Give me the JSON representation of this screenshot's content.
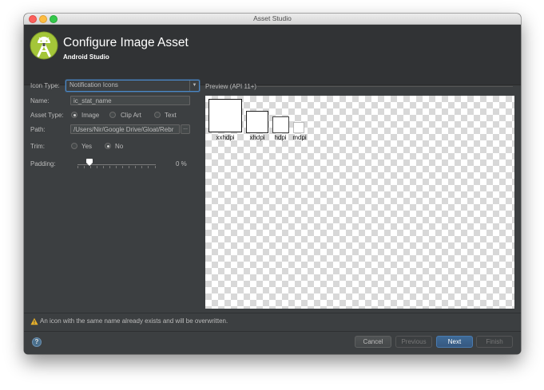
{
  "window": {
    "title": "Asset Studio"
  },
  "header": {
    "title": "Configure Image Asset",
    "subtitle": "Android Studio",
    "logo": "android-studio-logo"
  },
  "form": {
    "icon_type": {
      "label": "Icon Type:",
      "value": "Notification Icons"
    },
    "name": {
      "label": "Name:",
      "value": "ic_stat_name"
    },
    "asset_type": {
      "label": "Asset Type:",
      "options": [
        "Image",
        "Clip Art",
        "Text"
      ],
      "selected": "Image"
    },
    "path": {
      "label": "Path:",
      "value": "/Users/Nir/Google Drive/Gloat/Rebr",
      "browse_label": "..."
    },
    "trim": {
      "label": "Trim:",
      "options": [
        "Yes",
        "No"
      ],
      "selected": "No"
    },
    "padding": {
      "label": "Padding:",
      "value": 0,
      "value_text": "0 %"
    }
  },
  "preview": {
    "label": "Preview (API 11+)",
    "densities": [
      "xxhdpi",
      "xhdpi",
      "hdpi",
      "mdpi"
    ]
  },
  "warning": {
    "icon": "warning-icon",
    "text": "An icon with the same name already exists and will be overwritten."
  },
  "buttons": {
    "help": "?",
    "cancel": "Cancel",
    "previous": "Previous",
    "next": "Next",
    "finish": "Finish"
  },
  "colors": {
    "window_bg": "#3c3f41",
    "header_bg": "#313335",
    "accent": "#4a88c7",
    "default_button": "#365880",
    "android_green": "#a4c639"
  }
}
